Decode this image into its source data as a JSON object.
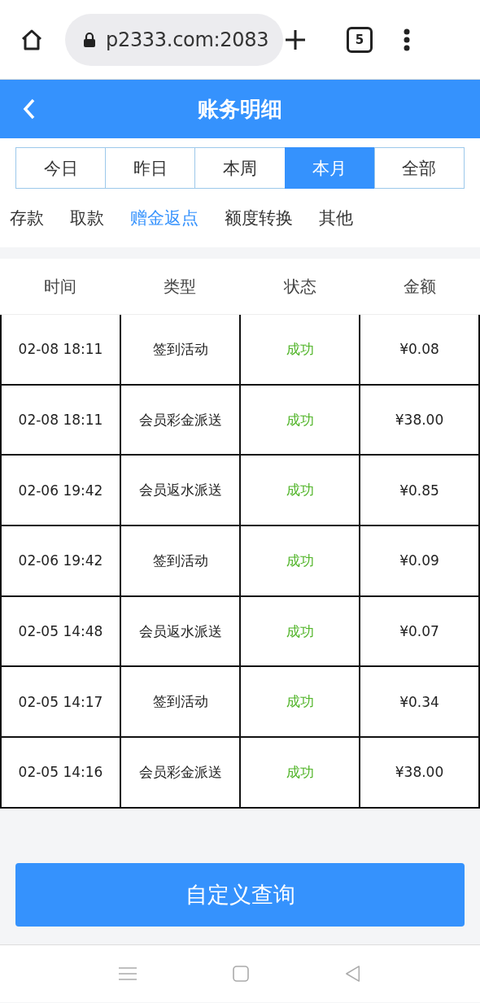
{
  "browser": {
    "url": "p2333.com:2083",
    "tab_count": "5"
  },
  "header": {
    "title": "账务明细"
  },
  "periods": [
    {
      "label": "今日",
      "selected": false
    },
    {
      "label": "昨日",
      "selected": false
    },
    {
      "label": "本周",
      "selected": false
    },
    {
      "label": "本月",
      "selected": true
    },
    {
      "label": "全部",
      "selected": false
    }
  ],
  "categories": [
    {
      "label": "存款",
      "selected": false
    },
    {
      "label": "取款",
      "selected": false
    },
    {
      "label": "赠金返点",
      "selected": true
    },
    {
      "label": "额度转换",
      "selected": false
    },
    {
      "label": "其他",
      "selected": false
    }
  ],
  "table": {
    "columns": [
      "时间",
      "类型",
      "状态",
      "金额"
    ],
    "rows": [
      {
        "time": "02-08 18:11",
        "type": "签到活动",
        "status": "成功",
        "amount": "¥0.08"
      },
      {
        "time": "02-08 18:11",
        "type": "会员彩金派送",
        "status": "成功",
        "amount": "¥38.00"
      },
      {
        "time": "02-06 19:42",
        "type": "会员返水派送",
        "status": "成功",
        "amount": "¥0.85"
      },
      {
        "time": "02-06 19:42",
        "type": "签到活动",
        "status": "成功",
        "amount": "¥0.09"
      },
      {
        "time": "02-05 14:48",
        "type": "会员返水派送",
        "status": "成功",
        "amount": "¥0.07"
      },
      {
        "time": "02-05 14:17",
        "type": "签到活动",
        "status": "成功",
        "amount": "¥0.34"
      },
      {
        "time": "02-05 14:16",
        "type": "会员彩金派送",
        "status": "成功",
        "amount": "¥38.00"
      }
    ]
  },
  "query_button": "自定义查询"
}
